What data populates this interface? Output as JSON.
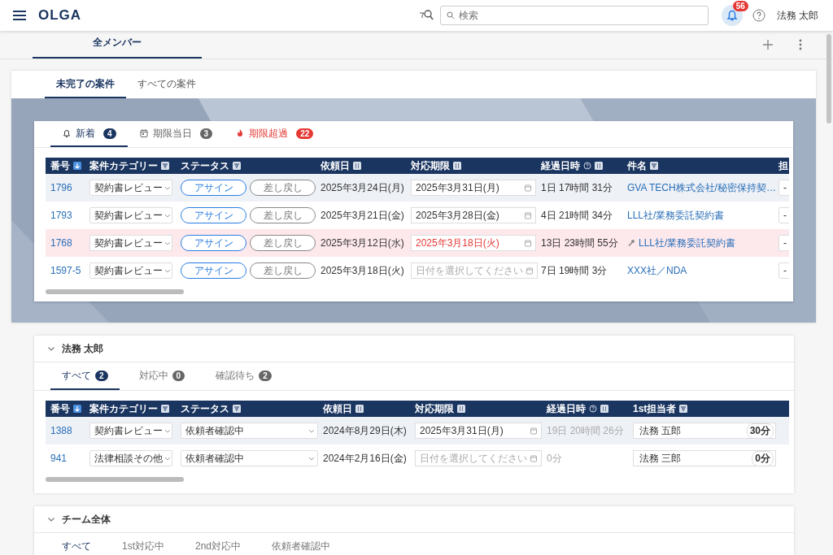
{
  "header": {
    "logo": "OLGA",
    "search": {
      "placeholder": "検索"
    },
    "notifications": {
      "count": "56"
    },
    "user": "法務 太郎"
  },
  "page_tabs": [
    {
      "label": "全メンバー",
      "selected": true
    }
  ],
  "case_tabs": [
    {
      "label": "未完了の案件",
      "selected": true
    },
    {
      "label": "すべての案件",
      "selected": false
    }
  ],
  "alert_panel": {
    "tabs": [
      {
        "kind": "new",
        "label": "新着",
        "count": "4",
        "selected": true
      },
      {
        "kind": "today",
        "label": "期限当日",
        "count": "3",
        "selected": false
      },
      {
        "kind": "overdue",
        "label": "期限超過",
        "count": "22",
        "selected": false
      }
    ],
    "table": {
      "columns": [
        {
          "label": "番号",
          "kind": "sorted"
        },
        {
          "label": "案件カテゴリー",
          "kind": "filter"
        },
        {
          "label": "ステータス",
          "kind": "filter"
        },
        {
          "label": "依頼日",
          "kind": "sort"
        },
        {
          "label": "対応期限",
          "kind": "sort"
        },
        {
          "label": "経過日時",
          "kind": "timed"
        },
        {
          "label": "件名",
          "kind": "filter"
        },
        {
          "label": "担",
          "kind": "plain"
        }
      ],
      "rows": [
        {
          "highlighted": true,
          "overdue": false,
          "cells": [
            {
              "kind": "link",
              "text": "1796",
              "flagged": false
            },
            {
              "kind": "select",
              "text": "契約書レビュー"
            },
            {
              "kind": "actions",
              "buttons": [
                "アサイン",
                "差し戻し"
              ]
            },
            {
              "kind": "text",
              "text": "2025年3月24日(月)",
              "muted": false
            },
            {
              "kind": "date",
              "value": "2025年3月31日(月)"
            },
            {
              "kind": "text",
              "text": "1日 17時間 31分",
              "muted": false
            },
            {
              "kind": "link",
              "text": "GVA TECH株式会社/秘密保持契…",
              "flagged": false
            },
            {
              "kind": "select",
              "text": "-"
            }
          ]
        },
        {
          "highlighted": false,
          "overdue": false,
          "cells": [
            {
              "kind": "link",
              "text": "1793",
              "flagged": false
            },
            {
              "kind": "select",
              "text": "契約書レビュー"
            },
            {
              "kind": "actions",
              "buttons": [
                "アサイン",
                "差し戻し"
              ]
            },
            {
              "kind": "text",
              "text": "2025年3月21日(金)",
              "muted": false
            },
            {
              "kind": "date",
              "value": "2025年3月28日(金)"
            },
            {
              "kind": "text",
              "text": "4日 21時間 34分",
              "muted": false
            },
            {
              "kind": "link",
              "text": "LLL社/業務委託契約書",
              "flagged": false
            },
            {
              "kind": "select",
              "text": "-"
            }
          ]
        },
        {
          "highlighted": false,
          "overdue": true,
          "cells": [
            {
              "kind": "link",
              "text": "1768",
              "flagged": false
            },
            {
              "kind": "select",
              "text": "契約書レビュー"
            },
            {
              "kind": "actions",
              "buttons": [
                "アサイン",
                "差し戻し"
              ]
            },
            {
              "kind": "text",
              "text": "2025年3月12日(水)",
              "muted": false
            },
            {
              "kind": "date",
              "value": "2025年3月18日(火)"
            },
            {
              "kind": "text",
              "text": "13日 23時間 55分",
              "muted": false
            },
            {
              "kind": "link",
              "text": "LLL社/業務委託契約書",
              "flagged": true
            },
            {
              "kind": "select",
              "text": "-"
            }
          ]
        },
        {
          "highlighted": false,
          "overdue": false,
          "cells": [
            {
              "kind": "link",
              "text": "1597-5",
              "flagged": false
            },
            {
              "kind": "select",
              "text": "契約書レビュー"
            },
            {
              "kind": "actions",
              "buttons": [
                "アサイン",
                "差し戻し"
              ]
            },
            {
              "kind": "text",
              "text": "2025年3月18日(火)",
              "muted": false
            },
            {
              "kind": "date",
              "placeholder": "日付を選択してください"
            },
            {
              "kind": "text",
              "text": "7日 19時間 3分",
              "muted": false
            },
            {
              "kind": "link",
              "text": "XXX社／NDA",
              "flagged": false
            },
            {
              "kind": "select",
              "text": "-"
            }
          ]
        }
      ]
    }
  },
  "sections": [
    {
      "title": "法務 太郎",
      "expanded": true,
      "tabs": [
        {
          "label": "すべて",
          "count": "2",
          "selected": true
        },
        {
          "label": "対応中",
          "count": "0",
          "selected": false
        },
        {
          "label": "確認待ち",
          "count": "2",
          "selected": false
        }
      ],
      "table": {
        "columns": [
          {
            "label": "番号",
            "kind": "sorted"
          },
          {
            "label": "案件カテゴリー",
            "kind": "filter"
          },
          {
            "label": "ステータス",
            "kind": "filter"
          },
          {
            "label": "依頼日",
            "kind": "sort"
          },
          {
            "label": "対応期限",
            "kind": "sort"
          },
          {
            "label": "経過日時",
            "kind": "timed"
          },
          {
            "label": "1st担当者",
            "kind": "filter"
          }
        ],
        "rows": [
          {
            "highlighted": true,
            "overdue": false,
            "cells": [
              {
                "kind": "link",
                "text": "1388",
                "flagged": false
              },
              {
                "kind": "select",
                "text": "契約書レビュー"
              },
              {
                "kind": "wide-select",
                "text": "依頼者確認中"
              },
              {
                "kind": "text",
                "text": "2024年8月29日(木)",
                "muted": false
              },
              {
                "kind": "date",
                "value": "2025年3月31日(月)"
              },
              {
                "kind": "text",
                "text": "19日 20時間 26分",
                "muted": true
              },
              {
                "kind": "assignee",
                "text": "法務 五郎",
                "time": "30分"
              }
            ]
          },
          {
            "highlighted": false,
            "overdue": false,
            "cells": [
              {
                "kind": "link",
                "text": "941",
                "flagged": false
              },
              {
                "kind": "select",
                "text": "法律相談その他"
              },
              {
                "kind": "wide-select",
                "text": "依頼者確認中"
              },
              {
                "kind": "text",
                "text": "2024年2月16日(金)",
                "muted": false
              },
              {
                "kind": "date",
                "placeholder": "日付を選択してください"
              },
              {
                "kind": "text",
                "text": "0分",
                "muted": true
              },
              {
                "kind": "assignee",
                "text": "法務 三郎",
                "time": "0分"
              }
            ]
          }
        ]
      }
    },
    {
      "title": "チーム全体",
      "expanded": true,
      "tabs": [
        {
          "label": "すべて",
          "selected": true
        },
        {
          "label": "1st対応中",
          "selected": false
        },
        {
          "label": "2nd対応中",
          "selected": false
        },
        {
          "label": "依頼者確認中",
          "selected": false
        }
      ]
    }
  ]
}
